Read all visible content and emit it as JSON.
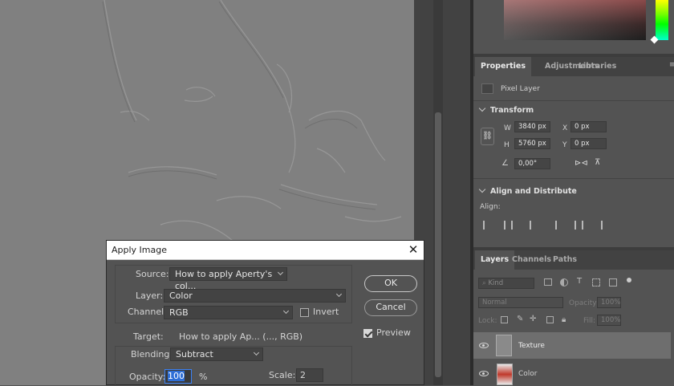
{
  "properties_panel": {
    "tabs": [
      "Properties",
      "Adjustments",
      "Libraries"
    ],
    "layer_type": "Pixel Layer",
    "transform": {
      "title": "Transform",
      "w_label": "W",
      "w_value": "3840 px",
      "h_label": "H",
      "h_value": "5760 px",
      "x_label": "X",
      "x_value": "0 px",
      "y_label": "Y",
      "y_value": "0 px",
      "angle_value": "0,00°"
    },
    "align": {
      "title": "Align and Distribute",
      "align_label": "Align:"
    }
  },
  "layers_panel": {
    "tabs": [
      "Layers",
      "Channels",
      "Paths"
    ],
    "filter_placeholder": "Kind",
    "blend_mode": "Normal",
    "opacity_label": "Opacity:",
    "opacity_value": "100%",
    "lock_label": "Lock:",
    "fill_label": "Fill:",
    "fill_value": "100%",
    "layers": [
      {
        "name": "Texture",
        "selected": true,
        "thumb_color": "#8a8a8a"
      },
      {
        "name": "Color",
        "selected": false,
        "thumb_color": "#c0392b"
      }
    ]
  },
  "apply_image_dialog": {
    "title": "Apply Image",
    "source_label": "Source:",
    "source_value": "How to apply Aperty's col...",
    "layer_label": "Layer:",
    "layer_value": "Color",
    "channel_label": "Channel:",
    "channel_value": "RGB",
    "invert_label": "Invert",
    "invert_checked": false,
    "target_label": "Target:",
    "target_value": "How to apply Ap... (..., RGB)",
    "blending_label": "Blending:",
    "blending_value": "Subtract",
    "opacity_label": "Opacity:",
    "opacity_value": "100",
    "opacity_unit": "%",
    "scale_label": "Scale:",
    "scale_value": "2",
    "ok_label": "OK",
    "cancel_label": "Cancel",
    "preview_label": "Preview",
    "preview_checked": true
  },
  "colors": {
    "canvas_gray": "#808080",
    "panel_bg": "#535353",
    "selected_layer": "#6e6e6e"
  }
}
